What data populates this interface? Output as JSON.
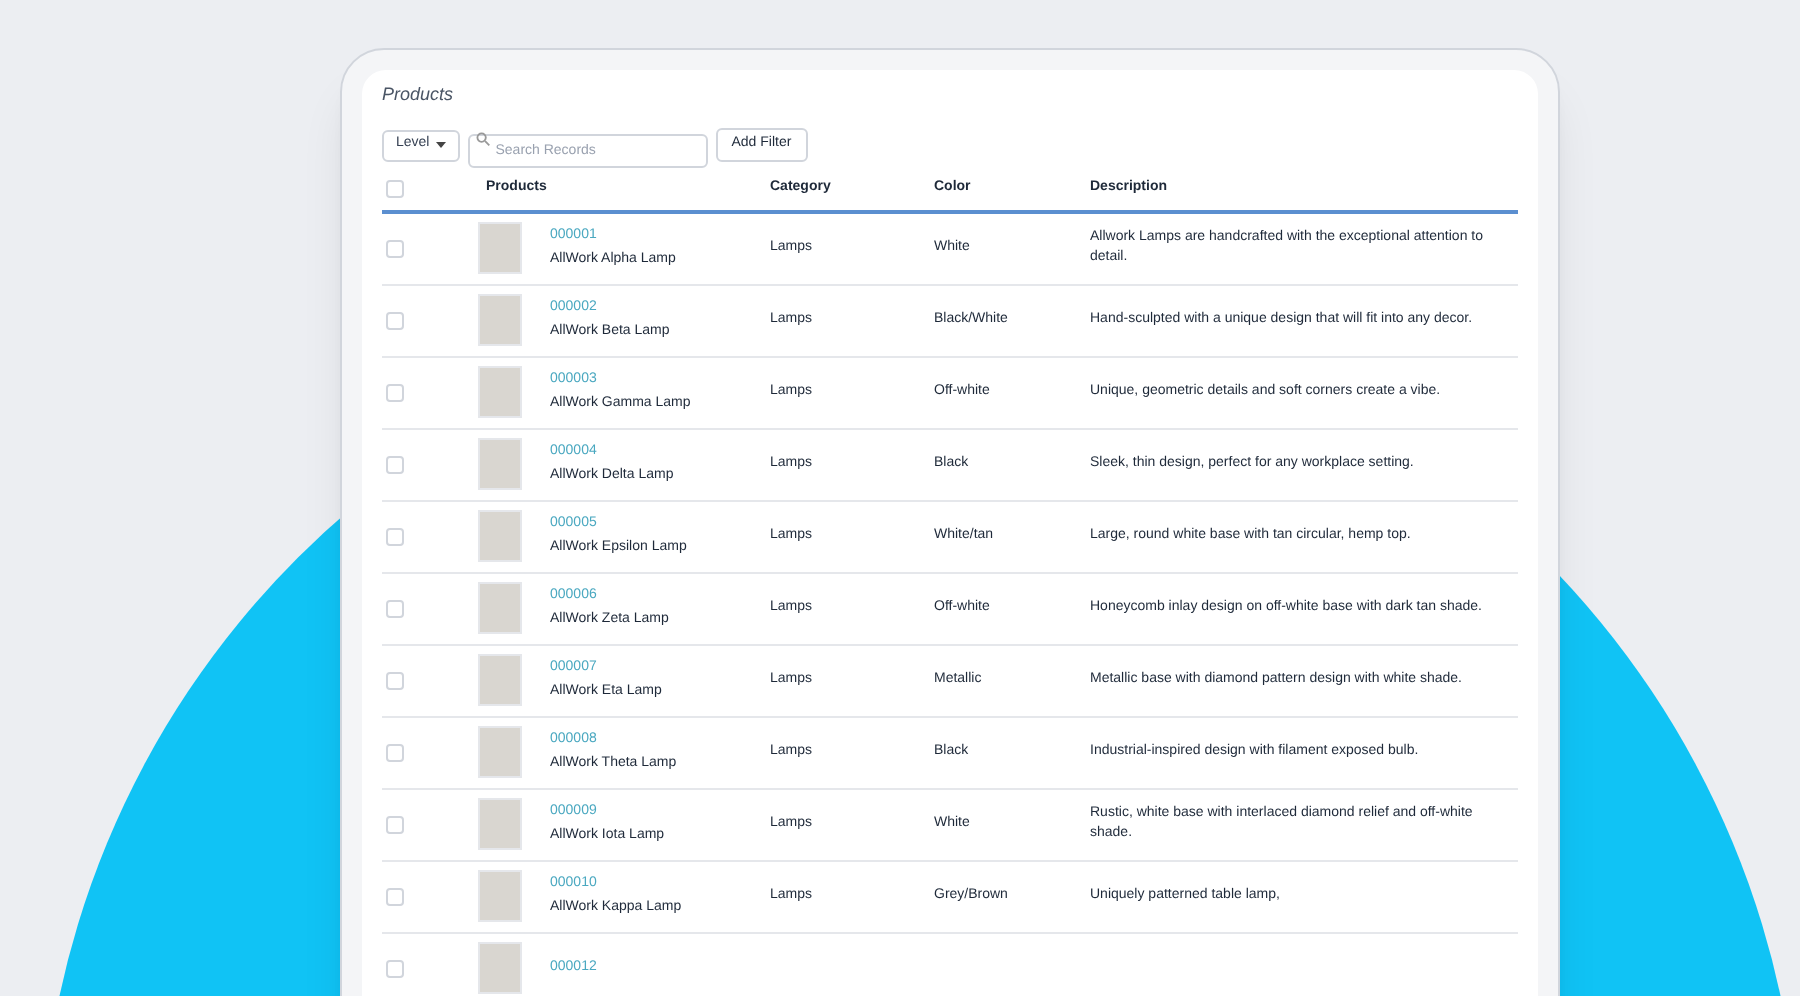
{
  "title": "Products",
  "toolbar": {
    "level_button": "Level",
    "search": {
      "placeholder": "Search Records"
    },
    "filter_button": "Add Filter"
  },
  "table": {
    "select_all_checked": false,
    "columns": [
      "Products",
      "Category",
      "Color",
      "Description"
    ],
    "rows": [
      {
        "checked": false,
        "code": "000001",
        "name": "AllWork Alpha Lamp",
        "category": "Lamps",
        "finish": "White",
        "description": "Allwork Lamps are handcrafted with the exceptional attention to detail."
      },
      {
        "checked": false,
        "code": "000002",
        "name": "AllWork Beta Lamp",
        "category": "Lamps",
        "finish": "Black/White",
        "description": "Hand-sculpted with a unique design that will fit into any decor."
      },
      {
        "checked": false,
        "code": "000003",
        "name": "AllWork Gamma Lamp",
        "category": "Lamps",
        "finish": "Off-white",
        "description": "Unique, geometric details and soft corners create a vibe."
      },
      {
        "checked": false,
        "code": "000004",
        "name": "AllWork Delta Lamp",
        "category": "Lamps",
        "finish": "Black",
        "description": "Sleek, thin design, perfect for any workplace setting."
      },
      {
        "checked": false,
        "code": "000005",
        "name": "AllWork Epsilon Lamp",
        "category": "Lamps",
        "finish": "White/tan",
        "description": "Large, round white base with tan circular, hemp top."
      },
      {
        "checked": false,
        "code": "000006",
        "name": "AllWork Zeta Lamp",
        "category": "Lamps",
        "finish": "Off-white",
        "description": "Honeycomb inlay design on off-white base with dark tan shade."
      },
      {
        "checked": false,
        "code": "000007",
        "name": "AllWork Eta Lamp",
        "category": "Lamps",
        "finish": "Metallic",
        "description": "Metallic base with diamond pattern design with white shade."
      },
      {
        "checked": false,
        "code": "000008",
        "name": "AllWork Theta Lamp",
        "category": "Lamps",
        "finish": "Black",
        "description": "Industrial-inspired design with filament exposed bulb."
      },
      {
        "checked": false,
        "code": "000009",
        "name": "AllWork Iota Lamp",
        "category": "Lamps",
        "finish": "White",
        "description": "Rustic, white base with interlaced diamond relief and off-white shade."
      },
      {
        "checked": false,
        "code": "000010",
        "name": "AllWork Kappa Lamp",
        "category": "Lamps",
        "finish": "Grey/Brown",
        "description": "Uniquely patterned table lamp,"
      },
      {
        "checked": false,
        "code": "000012"
      }
    ]
  }
}
